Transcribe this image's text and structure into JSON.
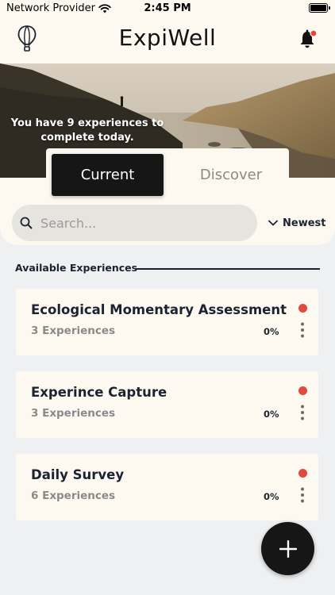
{
  "status_bar": {
    "carrier": "Network Provider",
    "time": "2:45 PM",
    "icons": [
      "wifi-icon",
      "battery-icon"
    ]
  },
  "header": {
    "title": "ExpiWell",
    "icons": [
      "hot-air-balloon-logo-icon",
      "bell-icon"
    ],
    "notification_dot_color": "#e04b3d"
  },
  "hero": {
    "message": "You have 9 experiences to complete today."
  },
  "tabs": {
    "current_label": "Current",
    "discover_label": "Discover",
    "selected": "Current"
  },
  "search": {
    "placeholder": "Search...",
    "value": ""
  },
  "sort": {
    "label": "Newest"
  },
  "section": {
    "title": "Available Experiences"
  },
  "cards": [
    {
      "title": "Ecological Momentary Assessment",
      "count": "3 Experiences",
      "progress": "0%",
      "status_color": "#e04b3d"
    },
    {
      "title": "Experince Capture",
      "count": "3 Experiences",
      "progress": "0%",
      "status_color": "#e04b3d"
    },
    {
      "title": "Daily Survey",
      "count": "6 Experiences",
      "progress": "0%",
      "status_color": "#e04b3d"
    }
  ],
  "colors": {
    "background": "#eff0f2",
    "surface": "#fdf9f1",
    "accent_dark": "#161616",
    "status_red": "#e04b3d"
  }
}
